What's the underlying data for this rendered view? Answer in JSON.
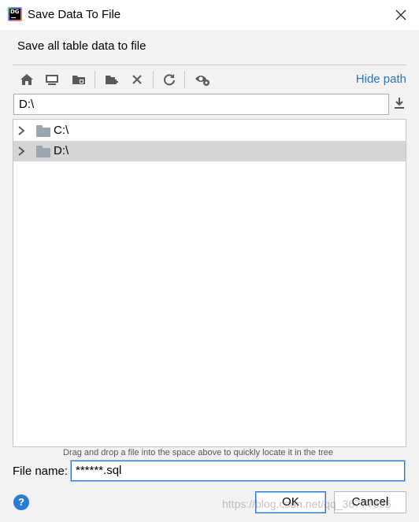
{
  "window": {
    "title": "Save Data To File",
    "app_icon_text": "DG"
  },
  "header": {
    "subtitle": "Save all table data to file"
  },
  "toolbar": {
    "icons": [
      "home-icon",
      "desktop-icon",
      "project-folder-icon",
      "new-folder-icon",
      "delete-icon",
      "refresh-icon",
      "show-hidden-icon"
    ],
    "hide_path_label": "Hide path"
  },
  "path": {
    "value": "D:\\"
  },
  "tree": {
    "items": [
      {
        "label": "C:\\",
        "selected": false
      },
      {
        "label": "D:\\",
        "selected": true
      }
    ]
  },
  "hint": "Drag and drop a file into the space above to quickly locate it in the tree",
  "filename": {
    "label": "File name:",
    "value": "******.sql"
  },
  "buttons": {
    "ok": "OK",
    "cancel": "Cancel"
  },
  "watermark": "https://blog.csdn.net/qq_36777695",
  "colors": {
    "link": "#2675bf",
    "focus": "#2b75c9",
    "help": "#2a7cd3",
    "selection": "#d5d5d5"
  }
}
